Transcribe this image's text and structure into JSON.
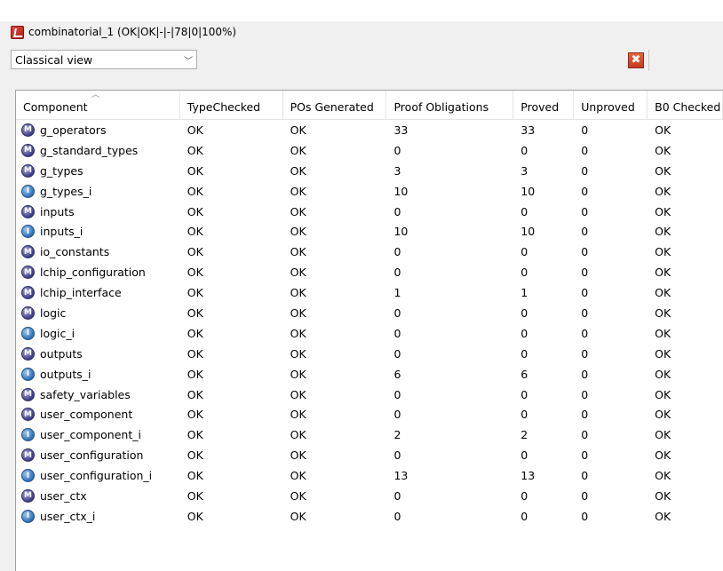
{
  "window": {
    "title": "combinatorial_1 (OK|OK|-|-|78|0|100%)"
  },
  "view_select": {
    "value": "Classical view"
  },
  "close_button": {
    "label": "✖"
  },
  "table": {
    "columns": [
      "Component",
      "TypeChecked",
      "POs Generated",
      "Proof Obligations",
      "Proved",
      "Unproved",
      "B0 Checked"
    ],
    "rows": [
      {
        "icon": "machine-icon",
        "component": "g_operators",
        "typechecked": "OK",
        "pos_generated": "OK",
        "proof_obligations": "33",
        "proved": "33",
        "unproved": "0",
        "b0_checked": "OK"
      },
      {
        "icon": "machine-icon",
        "component": "g_standard_types",
        "typechecked": "OK",
        "pos_generated": "OK",
        "proof_obligations": "0",
        "proved": "0",
        "unproved": "0",
        "b0_checked": "OK"
      },
      {
        "icon": "machine-icon",
        "component": "g_types",
        "typechecked": "OK",
        "pos_generated": "OK",
        "proof_obligations": "3",
        "proved": "3",
        "unproved": "0",
        "b0_checked": "OK"
      },
      {
        "icon": "implementation-icon",
        "component": "g_types_i",
        "typechecked": "OK",
        "pos_generated": "OK",
        "proof_obligations": "10",
        "proved": "10",
        "unproved": "0",
        "b0_checked": "OK"
      },
      {
        "icon": "machine-icon",
        "component": "inputs",
        "typechecked": "OK",
        "pos_generated": "OK",
        "proof_obligations": "0",
        "proved": "0",
        "unproved": "0",
        "b0_checked": "OK"
      },
      {
        "icon": "implementation-icon",
        "component": "inputs_i",
        "typechecked": "OK",
        "pos_generated": "OK",
        "proof_obligations": "10",
        "proved": "10",
        "unproved": "0",
        "b0_checked": "OK"
      },
      {
        "icon": "machine-icon",
        "component": "io_constants",
        "typechecked": "OK",
        "pos_generated": "OK",
        "proof_obligations": "0",
        "proved": "0",
        "unproved": "0",
        "b0_checked": "OK"
      },
      {
        "icon": "machine-icon",
        "component": "lchip_configuration",
        "typechecked": "OK",
        "pos_generated": "OK",
        "proof_obligations": "0",
        "proved": "0",
        "unproved": "0",
        "b0_checked": "OK"
      },
      {
        "icon": "machine-icon",
        "component": "lchip_interface",
        "typechecked": "OK",
        "pos_generated": "OK",
        "proof_obligations": "1",
        "proved": "1",
        "unproved": "0",
        "b0_checked": "OK"
      },
      {
        "icon": "machine-icon",
        "component": "logic",
        "typechecked": "OK",
        "pos_generated": "OK",
        "proof_obligations": "0",
        "proved": "0",
        "unproved": "0",
        "b0_checked": "OK"
      },
      {
        "icon": "implementation-icon",
        "component": "logic_i",
        "typechecked": "OK",
        "pos_generated": "OK",
        "proof_obligations": "0",
        "proved": "0",
        "unproved": "0",
        "b0_checked": "OK"
      },
      {
        "icon": "machine-icon",
        "component": "outputs",
        "typechecked": "OK",
        "pos_generated": "OK",
        "proof_obligations": "0",
        "proved": "0",
        "unproved": "0",
        "b0_checked": "OK"
      },
      {
        "icon": "implementation-icon",
        "component": "outputs_i",
        "typechecked": "OK",
        "pos_generated": "OK",
        "proof_obligations": "6",
        "proved": "6",
        "unproved": "0",
        "b0_checked": "OK"
      },
      {
        "icon": "machine-icon",
        "component": "safety_variables",
        "typechecked": "OK",
        "pos_generated": "OK",
        "proof_obligations": "0",
        "proved": "0",
        "unproved": "0",
        "b0_checked": "OK"
      },
      {
        "icon": "machine-icon",
        "component": "user_component",
        "typechecked": "OK",
        "pos_generated": "OK",
        "proof_obligations": "0",
        "proved": "0",
        "unproved": "0",
        "b0_checked": "OK"
      },
      {
        "icon": "implementation-icon",
        "component": "user_component_i",
        "typechecked": "OK",
        "pos_generated": "OK",
        "proof_obligations": "2",
        "proved": "2",
        "unproved": "0",
        "b0_checked": "OK"
      },
      {
        "icon": "machine-icon",
        "component": "user_configuration",
        "typechecked": "OK",
        "pos_generated": "OK",
        "proof_obligations": "0",
        "proved": "0",
        "unproved": "0",
        "b0_checked": "OK"
      },
      {
        "icon": "implementation-icon",
        "component": "user_configuration_i",
        "typechecked": "OK",
        "pos_generated": "OK",
        "proof_obligations": "13",
        "proved": "13",
        "unproved": "0",
        "b0_checked": "OK"
      },
      {
        "icon": "machine-icon",
        "component": "user_ctx",
        "typechecked": "OK",
        "pos_generated": "OK",
        "proof_obligations": "0",
        "proved": "0",
        "unproved": "0",
        "b0_checked": "OK"
      },
      {
        "icon": "implementation-icon",
        "component": "user_ctx_i",
        "typechecked": "OK",
        "pos_generated": "OK",
        "proof_obligations": "0",
        "proved": "0",
        "unproved": "0",
        "b0_checked": "OK"
      }
    ]
  }
}
